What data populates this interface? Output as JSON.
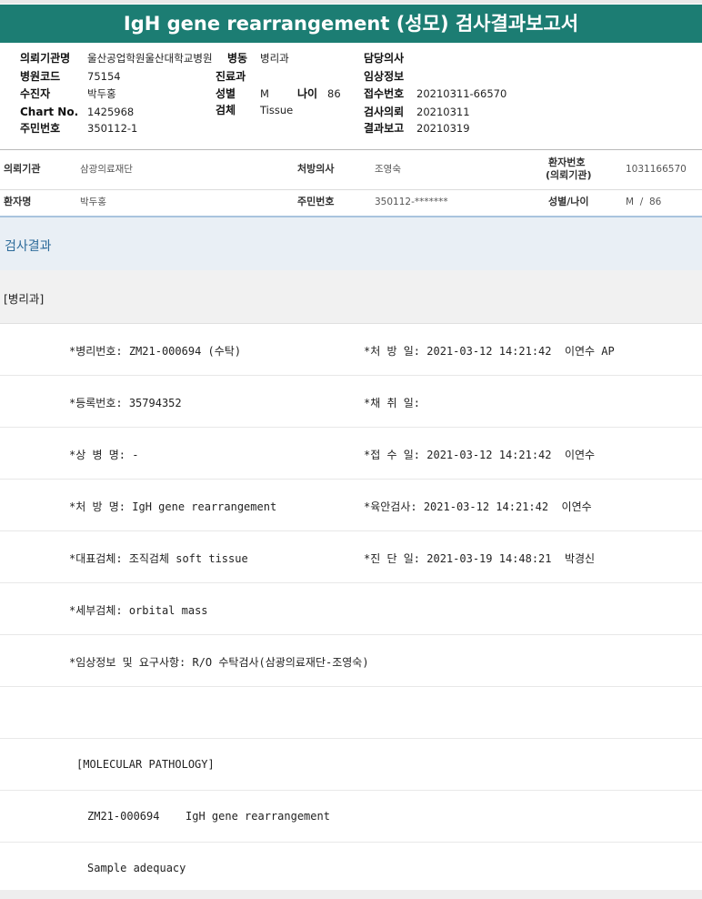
{
  "report": {
    "title": "IgH gene rearrangement (성모) 검사결과보고서"
  },
  "header": {
    "col1": [
      {
        "label": "의뢰기관명",
        "value": "울산공업학원울산대학교병원"
      },
      {
        "label": "병원코드",
        "value": "75154"
      },
      {
        "label": "수진자",
        "value": "박두홍"
      },
      {
        "label": "Chart No.",
        "value": "1425968"
      },
      {
        "label": "주민번호",
        "value": "350112-1"
      }
    ],
    "col2": [
      {
        "label": "병동",
        "value": "병리과"
      },
      {
        "label": "진료과",
        "value": ""
      },
      {
        "label": "성별",
        "value": "M"
      },
      {
        "label": "검체",
        "value": "Tissue"
      }
    ],
    "age": {
      "label": "나이",
      "value": "86"
    },
    "col3": [
      {
        "label": "담당의사",
        "value": ""
      },
      {
        "label": "임상정보",
        "value": ""
      },
      {
        "label": "접수번호",
        "value": "20210311-66570"
      },
      {
        "label": "검사의뢰",
        "value": "20210311"
      },
      {
        "label": "결과보고",
        "value": "20210319"
      }
    ]
  },
  "patient_info": {
    "row1": {
      "l1": "의뢰기관",
      "v1": "삼광의료재단",
      "l2": "처방의사",
      "v2": "조영숙",
      "l3a": "환자번호",
      "l3b": "(의뢰기관)",
      "v3": "1031166570"
    },
    "row2": {
      "l1": "환자명",
      "v1": "박두홍",
      "l2": "주민번호",
      "v2": "350112-*******",
      "l3": "성별/나이",
      "v3": "M  /  86"
    }
  },
  "results": {
    "section_title": "검사결과",
    "department": "[병리과]",
    "rows": [
      {
        "left": "*병리번호: ZM21-000694 (수탁)",
        "right": "*처 방 일: 2021-03-12 14:21:42  이연수 AP"
      },
      {
        "left": "*등록번호: 35794352",
        "right": "*채 취 일:"
      },
      {
        "left": "*상 병 명: -",
        "right": "*접 수 일: 2021-03-12 14:21:42  이연수"
      },
      {
        "left": "*처 방 명: IgH gene rearrangement",
        "right": "*육안검사: 2021-03-12 14:21:42  이연수"
      },
      {
        "left": "*대표검체: 조직검체 soft tissue",
        "right": "*진 단 일: 2021-03-19 14:48:21  박경신"
      },
      {
        "left": "*세부검체: orbital mass",
        "right": ""
      },
      {
        "left": "*임상정보 및 요구사항: R/O 수탁검사(삼광의료재단-조영숙)",
        "right": ""
      }
    ],
    "molecular": {
      "section": "[MOLECULAR PATHOLOGY]",
      "case_no": "ZM21-000694",
      "test_name": "IgH gene rearrangement",
      "sample_line": "Sample adequacy"
    }
  }
}
